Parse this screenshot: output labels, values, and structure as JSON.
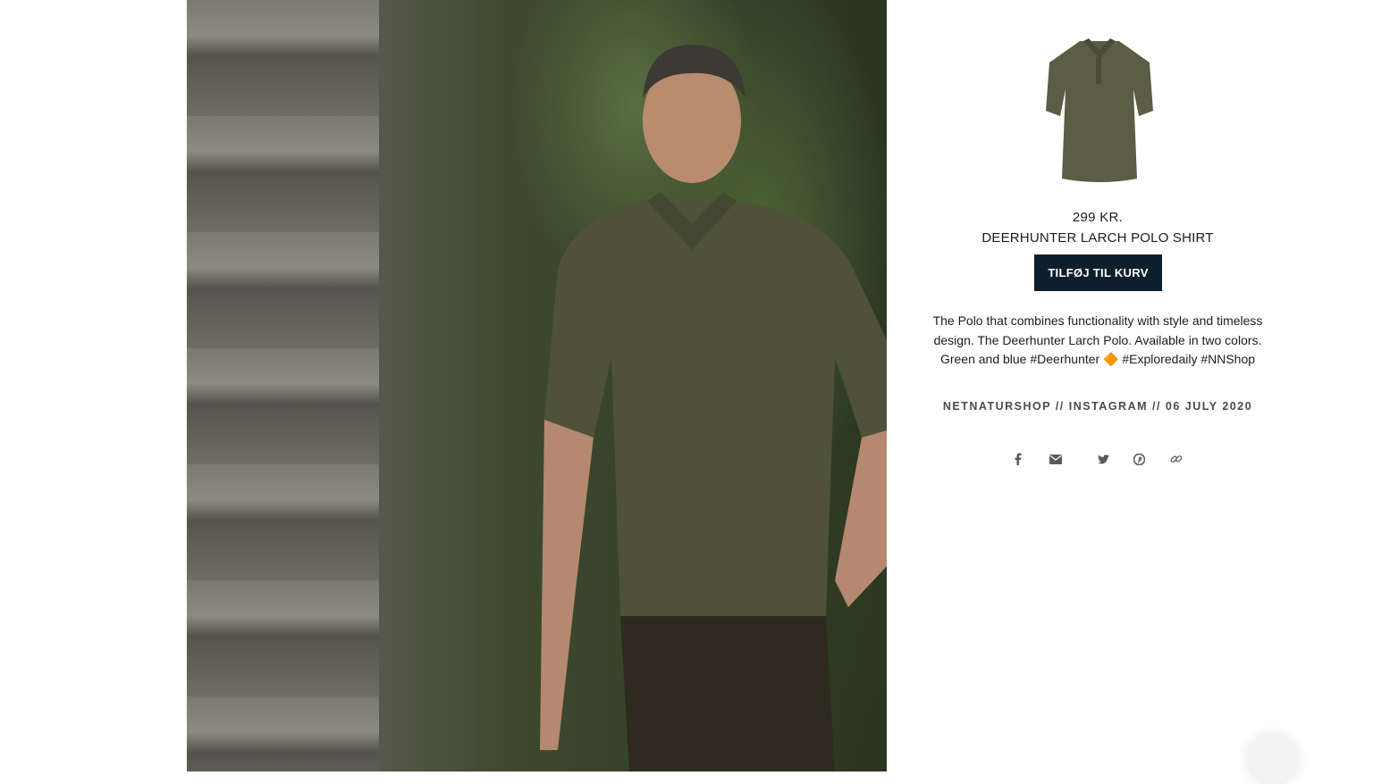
{
  "product": {
    "price": "299 KR.",
    "name": "DEERHUNTER LARCH POLO SHIRT",
    "add_to_cart_label": "TILFØJ TIL KURV"
  },
  "post": {
    "description": "The Polo that combines functionality with style and timeless design. The Deerhunter Larch Polo. Available in two colors. Green and blue #Deerhunter 🔶 #Exploredaily #NNShop",
    "meta": "NETNATURSHOP // INSTAGRAM // 06 JULY 2020"
  },
  "share_icons": [
    "facebook-icon",
    "mail-icon",
    "twitter-icon",
    "pinterest-icon",
    "link-icon"
  ],
  "colors": {
    "button_bg": "#0f1e2d",
    "shirt": "#4f5238",
    "text": "#1c1c1c"
  }
}
